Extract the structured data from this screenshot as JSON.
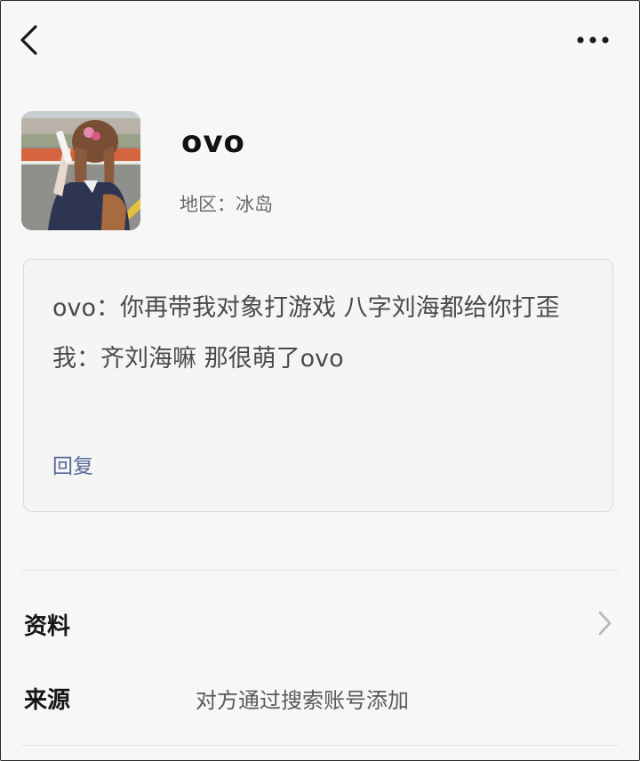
{
  "header": {
    "back_icon": "chevron-left-icon",
    "more_icon": "more-dots-icon"
  },
  "profile": {
    "name": "ovo",
    "region": "地区：冰岛"
  },
  "message": {
    "lines": [
      "ovo：你再带我对象打游戏 八字刘海都给你打歪",
      "我：齐刘海嘛 那很萌了ovo"
    ],
    "reply_label": "回复"
  },
  "rows": {
    "profile_label": "资料",
    "profile_icon": "chevron-right-icon",
    "source_label": "来源",
    "source_value": "对方通过搜索账号添加"
  },
  "colors": {
    "background": "#f7f7f7",
    "reply_link": "#566a95",
    "muted_text": "#6b6b6b"
  }
}
